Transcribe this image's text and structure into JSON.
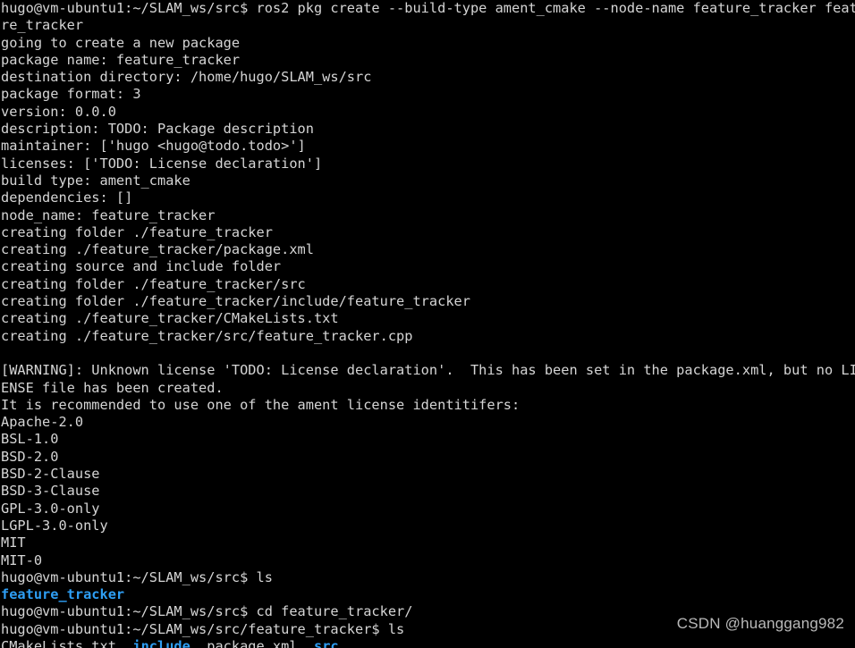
{
  "terminal": {
    "title": "hugo@vm-ubuntu1: ~/SLAM_ws/src",
    "background_color": "#000000",
    "foreground_color": "#d5d5d5",
    "directory_color": "#2e9ef4",
    "columns": 104,
    "rows": 38,
    "prompt_src": "hugo@vm-ubuntu1:~/SLAM_ws/src$ ",
    "prompt_pkg": "hugo@vm-ubuntu1:~/SLAM_ws/src/feature_tracker$ ",
    "lines": [
      {
        "id": "cmd-ros2-pkg-create-wrap1",
        "segments": [
          {
            "text": "hugo@vm-ubuntu1:~/SLAM_ws/src$ ros2 pkg create --build-type ament_cmake --node-name feature_tracker featu",
            "style": "plain"
          }
        ]
      },
      {
        "id": "cmd-ros2-pkg-create-wrap2",
        "segments": [
          {
            "text": "re_tracker",
            "style": "plain"
          }
        ]
      },
      {
        "id": "out-going-to-create",
        "segments": [
          {
            "text": "going to create a new package",
            "style": "plain"
          }
        ]
      },
      {
        "id": "out-package-name",
        "segments": [
          {
            "text": "package name: feature_tracker",
            "style": "plain"
          }
        ]
      },
      {
        "id": "out-destination-directory",
        "segments": [
          {
            "text": "destination directory: /home/hugo/SLAM_ws/src",
            "style": "plain"
          }
        ]
      },
      {
        "id": "out-package-format",
        "segments": [
          {
            "text": "package format: 3",
            "style": "plain"
          }
        ]
      },
      {
        "id": "out-version",
        "segments": [
          {
            "text": "version: 0.0.0",
            "style": "plain"
          }
        ]
      },
      {
        "id": "out-description",
        "segments": [
          {
            "text": "description: TODO: Package description",
            "style": "plain"
          }
        ]
      },
      {
        "id": "out-maintainer",
        "segments": [
          {
            "text": "maintainer: ['hugo <hugo@todo.todo>']",
            "style": "plain"
          }
        ]
      },
      {
        "id": "out-licenses",
        "segments": [
          {
            "text": "licenses: ['TODO: License declaration']",
            "style": "plain"
          }
        ]
      },
      {
        "id": "out-build-type",
        "segments": [
          {
            "text": "build type: ament_cmake",
            "style": "plain"
          }
        ]
      },
      {
        "id": "out-dependencies",
        "segments": [
          {
            "text": "dependencies: []",
            "style": "plain"
          }
        ]
      },
      {
        "id": "out-node-name",
        "segments": [
          {
            "text": "node_name: feature_tracker",
            "style": "plain"
          }
        ]
      },
      {
        "id": "out-creating-folder-root",
        "segments": [
          {
            "text": "creating folder ./feature_tracker",
            "style": "plain"
          }
        ]
      },
      {
        "id": "out-creating-package-xml",
        "segments": [
          {
            "text": "creating ./feature_tracker/package.xml",
            "style": "plain"
          }
        ]
      },
      {
        "id": "out-creating-source-include",
        "segments": [
          {
            "text": "creating source and include folder",
            "style": "plain"
          }
        ]
      },
      {
        "id": "out-creating-folder-src",
        "segments": [
          {
            "text": "creating folder ./feature_tracker/src",
            "style": "plain"
          }
        ]
      },
      {
        "id": "out-creating-folder-include",
        "segments": [
          {
            "text": "creating folder ./feature_tracker/include/feature_tracker",
            "style": "plain"
          }
        ]
      },
      {
        "id": "out-creating-cmakelists",
        "segments": [
          {
            "text": "creating ./feature_tracker/CMakeLists.txt",
            "style": "plain"
          }
        ]
      },
      {
        "id": "out-creating-cpp",
        "segments": [
          {
            "text": "creating ./feature_tracker/src/feature_tracker.cpp",
            "style": "plain"
          }
        ]
      },
      {
        "id": "blank-1",
        "segments": [
          {
            "text": "",
            "style": "plain"
          }
        ]
      },
      {
        "id": "warn-unknown-license-wrap1",
        "segments": [
          {
            "text": "[WARNING]: Unknown license 'TODO: License declaration'.  This has been set in the package.xml, but no LIC",
            "style": "plain"
          }
        ]
      },
      {
        "id": "warn-unknown-license-wrap2",
        "segments": [
          {
            "text": "ENSE file has been created.",
            "style": "plain"
          }
        ]
      },
      {
        "id": "warn-recommended-identifiers",
        "segments": [
          {
            "text": "It is recommended to use one of the ament license identitifers:",
            "style": "plain"
          }
        ]
      },
      {
        "id": "license-apache-2-0",
        "segments": [
          {
            "text": "Apache-2.0",
            "style": "plain"
          }
        ]
      },
      {
        "id": "license-bsl-1-0",
        "segments": [
          {
            "text": "BSL-1.0",
            "style": "plain"
          }
        ]
      },
      {
        "id": "license-bsd-2-0",
        "segments": [
          {
            "text": "BSD-2.0",
            "style": "plain"
          }
        ]
      },
      {
        "id": "license-bsd-2-clause",
        "segments": [
          {
            "text": "BSD-2-Clause",
            "style": "plain"
          }
        ]
      },
      {
        "id": "license-bsd-3-clause",
        "segments": [
          {
            "text": "BSD-3-Clause",
            "style": "plain"
          }
        ]
      },
      {
        "id": "license-gpl-3-0-only",
        "segments": [
          {
            "text": "GPL-3.0-only",
            "style": "plain"
          }
        ]
      },
      {
        "id": "license-lgpl-3-0-only",
        "segments": [
          {
            "text": "LGPL-3.0-only",
            "style": "plain"
          }
        ]
      },
      {
        "id": "license-mit",
        "segments": [
          {
            "text": "MIT",
            "style": "plain"
          }
        ]
      },
      {
        "id": "license-mit-0",
        "segments": [
          {
            "text": "MIT-0",
            "style": "plain"
          }
        ]
      },
      {
        "id": "cmd-ls-src",
        "segments": [
          {
            "text": "hugo@vm-ubuntu1:~/SLAM_ws/src$ ls",
            "style": "plain"
          }
        ]
      },
      {
        "id": "out-ls-src",
        "segments": [
          {
            "text": "feature_tracker",
            "style": "dir"
          }
        ]
      },
      {
        "id": "cmd-cd-feature-tracker",
        "segments": [
          {
            "text": "hugo@vm-ubuntu1:~/SLAM_ws/src$ cd feature_tracker/",
            "style": "plain"
          }
        ]
      },
      {
        "id": "cmd-ls-pkg",
        "segments": [
          {
            "text": "hugo@vm-ubuntu1:~/SLAM_ws/src/feature_tracker$ ls",
            "style": "plain"
          }
        ]
      },
      {
        "id": "out-ls-pkg",
        "segments": [
          {
            "text": "CMakeLists.txt",
            "style": "plain"
          },
          {
            "text": "  ",
            "style": "plain"
          },
          {
            "text": "include",
            "style": "dir"
          },
          {
            "text": "  ",
            "style": "plain"
          },
          {
            "text": "package.xml",
            "style": "plain"
          },
          {
            "text": "  ",
            "style": "plain"
          },
          {
            "text": "src",
            "style": "dir"
          }
        ]
      }
    ]
  },
  "watermark": {
    "text": "CSDN @huanggang982",
    "color": "#b9b9b9"
  }
}
